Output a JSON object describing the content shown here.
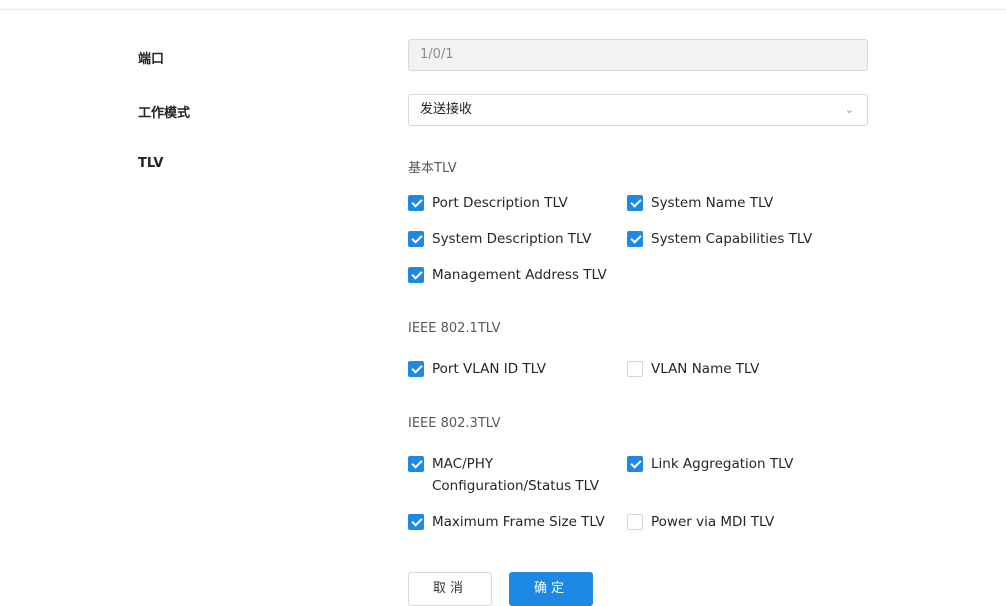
{
  "form": {
    "port_label": "端口",
    "port_value": "1/0/1",
    "mode_label": "工作模式",
    "mode_value": "发送接收",
    "tlv_label": "TLV"
  },
  "sections": {
    "basic_title": "基本TLV",
    "ieee8021_title": "IEEE 802.1TLV",
    "ieee8023_title": "IEEE 802.3TLV"
  },
  "checkboxes": {
    "port_description": {
      "label": "Port Description TLV",
      "checked": true
    },
    "system_name": {
      "label": "System Name TLV",
      "checked": true
    },
    "system_description": {
      "label": "System Description TLV",
      "checked": true
    },
    "system_capabilities": {
      "label": "System Capabilities TLV",
      "checked": true
    },
    "management_address": {
      "label": "Management Address TLV",
      "checked": true
    },
    "port_vlan_id": {
      "label": "Port VLAN ID TLV",
      "checked": true
    },
    "vlan_name": {
      "label": "VLAN Name TLV",
      "checked": false
    },
    "mac_phy": {
      "label": "MAC/PHY Configuration/Status TLV",
      "checked": true
    },
    "link_aggregation": {
      "label": "Link Aggregation TLV",
      "checked": true
    },
    "max_frame_size": {
      "label": "Maximum Frame Size TLV",
      "checked": true
    },
    "power_via_mdi": {
      "label": "Power via MDI TLV",
      "checked": false
    }
  },
  "buttons": {
    "cancel_label": "取消",
    "confirm_label": "确定"
  },
  "icons": {
    "dropdown": "chevron-down-icon",
    "checked": "checkmark-icon"
  },
  "colors": {
    "accent": "#1e88e5",
    "disabled_bg": "#f2f2f2"
  }
}
